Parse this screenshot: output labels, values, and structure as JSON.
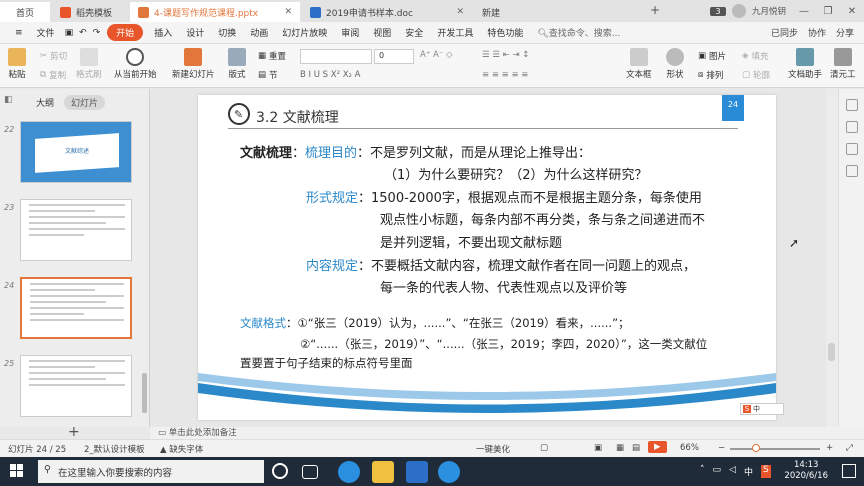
{
  "titlebar": {
    "tabs": [
      {
        "label": "首页"
      },
      {
        "label": "稻壳模板"
      },
      {
        "label": "4-课题写作规范课程.pptx"
      },
      {
        "label": "2019申请书样本.doc"
      },
      {
        "label": "新建"
      }
    ],
    "tab_count": "3",
    "user": "九月悦钥"
  },
  "menubar": {
    "file": "文件",
    "items": [
      "开始",
      "插入",
      "设计",
      "切换",
      "动画",
      "幻灯片放映",
      "审阅",
      "视图",
      "安全",
      "开发工具",
      "特色功能"
    ],
    "search": "查找命令、搜索...",
    "sync": "已同步",
    "collab": "协作",
    "share": "分享"
  },
  "ribbon": {
    "paste": "粘贴",
    "cut": "剪切",
    "copy": "复制",
    "format_painter": "格式刷",
    "play_from_current": "从当前开始",
    "new_slide": "新建幻灯片",
    "layout": "版式",
    "reset": "重置",
    "section": "节",
    "font_size": "0",
    "picture": "图片",
    "fill": "填充",
    "textbox": "文本框",
    "shape": "形状",
    "arrange": "排列",
    "outline": "轮廓",
    "doc_assistant": "文档助手",
    "clean_tool": "清元工"
  },
  "leftpanel": {
    "tab_outline": "大纲",
    "tab_slides": "幻灯片",
    "thumbs": [
      {
        "num": "22",
        "title": "文献综述"
      },
      {
        "num": "23",
        "title": ""
      },
      {
        "num": "24",
        "title": ""
      },
      {
        "num": "25",
        "title": ""
      }
    ],
    "add": "+"
  },
  "slide": {
    "section_title": "3.2 文献梳理",
    "page_no": "24",
    "lines": {
      "l1a": "文献梳理",
      "l1b": "：",
      "l1c": "梳理目的",
      "l1d": "：不是罗列文献，而是从理论上推导出：",
      "l2": "（1）为什么要研究？（2）为什么这样研究？",
      "l3a": "形式规定",
      "l3b": "：1500-2000字，根据观点而不是根据主题分条，每条使用",
      "l4": "观点性小标题，每条内部不再分类，条与条之间递进而不",
      "l5": "是并列逻辑，不要出现文献标题",
      "l6a": "内容规定",
      "l6b": "：不要概括文献内容，梳理文献作者在同一问题上的观点，",
      "l7": "每一条的代表人物、代表性观点以及评价等",
      "l8a": "文献格式",
      "l8b": "：①“张三（2019）认为，......”、“在张三（2019）看来，......”；",
      "l9": "②“......（张三，2019）”、“......（张三，2019；李四，2020）”，这一类文献位",
      "l10": "置要置于句子结束的标点符号里面"
    }
  },
  "notes": "单击此处添加备注",
  "statusbar": {
    "slide_info": "幻灯片 24 / 25",
    "template": "2_默认设计模板",
    "missing_font": "缺失字体",
    "beautify": "一键美化",
    "zoom": "66%"
  },
  "taskbar": {
    "search_placeholder": "在这里输入你要搜索的内容",
    "time": "14:13",
    "date": "2020/6/16",
    "ime": "中"
  }
}
